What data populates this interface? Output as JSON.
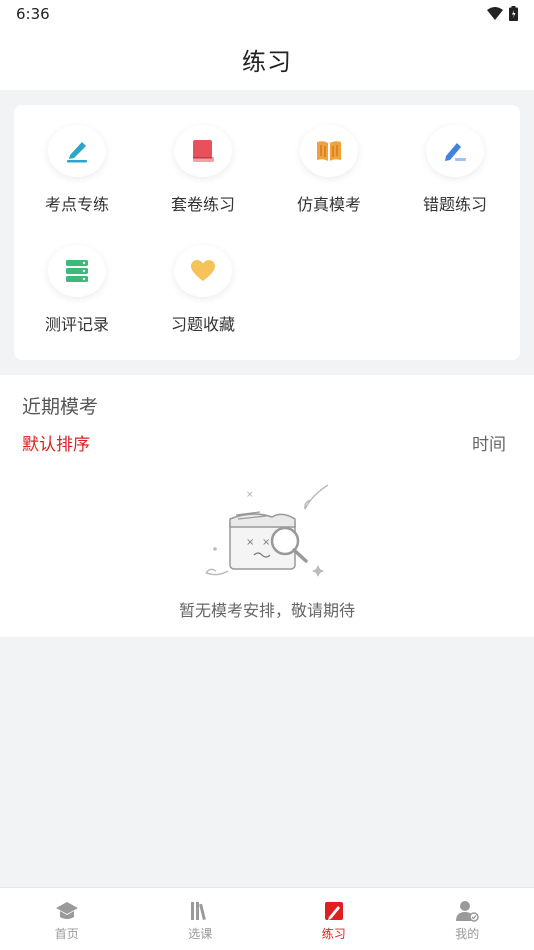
{
  "status": {
    "time": "6:36"
  },
  "header": {
    "title": "练习"
  },
  "menu": {
    "items": [
      {
        "label": "考点专练",
        "icon": "pen-icon"
      },
      {
        "label": "套卷练习",
        "icon": "book-icon"
      },
      {
        "label": "仿真模考",
        "icon": "open-book-icon"
      },
      {
        "label": "错题练习",
        "icon": "edit-icon"
      },
      {
        "label": "测评记录",
        "icon": "records-icon"
      },
      {
        "label": "习题收藏",
        "icon": "heart-icon"
      }
    ]
  },
  "recent": {
    "title": "近期模考",
    "sort_default": "默认排序",
    "sort_time": "时间",
    "empty_text": "暂无模考安排，敬请期待"
  },
  "tabbar": {
    "items": [
      {
        "label": "首页",
        "icon": "graduation-cap-icon"
      },
      {
        "label": "选课",
        "icon": "books-icon"
      },
      {
        "label": "练习",
        "icon": "practice-icon",
        "active": true
      },
      {
        "label": "我的",
        "icon": "user-icon"
      }
    ]
  },
  "colors": {
    "accent": "#e02020",
    "background": "#f2f3f5"
  }
}
